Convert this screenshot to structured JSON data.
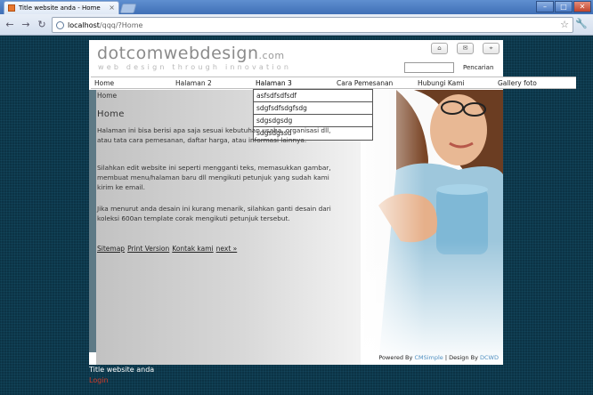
{
  "browser": {
    "tab_title": "Title website anda - Home",
    "tab_close": "×",
    "url_host": "localhost",
    "url_path": "/qqq/?Home",
    "back_glyph": "←",
    "forward_glyph": "→",
    "reload_glyph": "↻",
    "star_glyph": "☆",
    "wrench_glyph": "🔧",
    "min_glyph": "–",
    "max_glyph": "□",
    "close_glyph": "✕"
  },
  "header": {
    "logo_main": "dotcomwebdesign",
    "logo_suffix": ".com",
    "tagline": "web design through innovation",
    "icon_home": "⌂",
    "icon_mail": "✉",
    "icon_sitemap": "⌖",
    "search_label": "Pencarian",
    "search_value": ""
  },
  "menu": {
    "items": [
      "Home",
      "Halaman 2",
      "Halaman 3",
      "Cara Pemesanan",
      "Hubungi Kami",
      "Gallery foto"
    ],
    "dropdown": [
      "asfsdfsdfsdf",
      "sdgfsdfsdgfsdg",
      "sdgsdgsdg",
      "sdgsdgssd"
    ]
  },
  "content": {
    "breadcrumb": "Home",
    "heading": "Home",
    "p1": "Halaman ini bisa berisi apa saja sesuai kebutuhan usaha, organisasi dll, atau tata cara pemesanan, daftar harga, atau informasi lainnya.",
    "p2": "Silahkan edit website ini seperti mengganti teks, memasukkan gambar, membuat menu/halaman baru dll mengikuti petunjuk yang sudah kami kirim ke email.",
    "p3": "Jika menurut anda desain ini kurang menarik, silahkan ganti desain dari koleksi 600an template corak mengikuti petunjuk tersebut.",
    "links": [
      "Sitemap",
      "Print Version",
      "Kontak kami",
      "next »"
    ]
  },
  "footer": {
    "powered_prefix": "Powered By",
    "powered_cms": "CMSimple",
    "powered_mid": "| Design By",
    "powered_design": "DCWD"
  },
  "below": {
    "site_title": "Title website anda",
    "login": "Login"
  }
}
